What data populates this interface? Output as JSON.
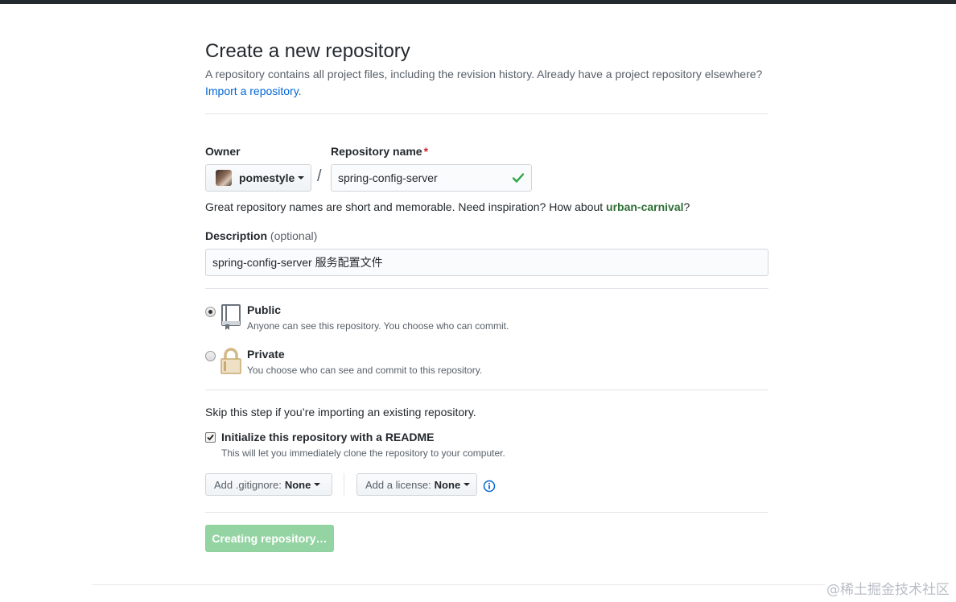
{
  "header": {
    "title": "Create a new repository",
    "description": "A repository contains all project files, including the revision history. Already have a project repository elsewhere?",
    "import_link": "Import a repository",
    "import_period": "."
  },
  "owner": {
    "label": "Owner",
    "value": "pomestyle"
  },
  "repo_name": {
    "label": "Repository name",
    "required_mark": "*",
    "value": "spring-config-server",
    "valid": true
  },
  "hint": {
    "text": "Great repository names are short and memorable. Need inspiration? How about ",
    "suggestion": "urban-carnival",
    "end": "?"
  },
  "description_field": {
    "label": "Description",
    "optional": "(optional)",
    "value": "spring-config-server 服务配置文件"
  },
  "visibility": {
    "selected": "public",
    "public": {
      "title": "Public",
      "note": "Anyone can see this repository. You choose who can commit."
    },
    "private": {
      "title": "Private",
      "note": "You choose who can see and commit to this repository."
    }
  },
  "init": {
    "skip_text": "Skip this step if you’re importing an existing repository.",
    "readme_label": "Initialize this repository with a README",
    "readme_note": "This will let you immediately clone the repository to your computer.",
    "readme_checked": true
  },
  "selects": {
    "gitignore_label": "Add .gitignore:",
    "gitignore_value": "None",
    "license_label": "Add a license:",
    "license_value": "None"
  },
  "submit": {
    "label": "Creating repository…"
  },
  "watermark": "@稀土掘金技术社区",
  "colors": {
    "link": "#0366d6",
    "success": "#28a745",
    "button_disabled": "#94d3a2",
    "required": "#cb2431"
  },
  "icons": {
    "valid": "check-icon",
    "public": "repo-book-icon",
    "private": "lock-icon",
    "info": "info-icon"
  }
}
